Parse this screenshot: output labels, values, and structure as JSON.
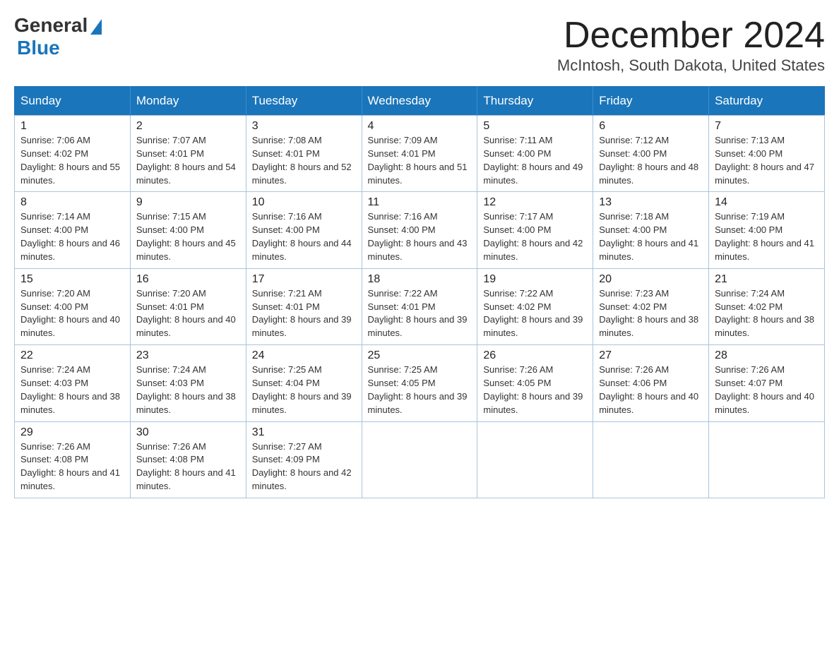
{
  "logo": {
    "general": "General",
    "blue": "Blue"
  },
  "title": "December 2024",
  "location": "McIntosh, South Dakota, United States",
  "days_of_week": [
    "Sunday",
    "Monday",
    "Tuesday",
    "Wednesday",
    "Thursday",
    "Friday",
    "Saturday"
  ],
  "weeks": [
    [
      {
        "day": "1",
        "sunrise": "7:06 AM",
        "sunset": "4:02 PM",
        "daylight": "8 hours and 55 minutes."
      },
      {
        "day": "2",
        "sunrise": "7:07 AM",
        "sunset": "4:01 PM",
        "daylight": "8 hours and 54 minutes."
      },
      {
        "day": "3",
        "sunrise": "7:08 AM",
        "sunset": "4:01 PM",
        "daylight": "8 hours and 52 minutes."
      },
      {
        "day": "4",
        "sunrise": "7:09 AM",
        "sunset": "4:01 PM",
        "daylight": "8 hours and 51 minutes."
      },
      {
        "day": "5",
        "sunrise": "7:11 AM",
        "sunset": "4:00 PM",
        "daylight": "8 hours and 49 minutes."
      },
      {
        "day": "6",
        "sunrise": "7:12 AM",
        "sunset": "4:00 PM",
        "daylight": "8 hours and 48 minutes."
      },
      {
        "day": "7",
        "sunrise": "7:13 AM",
        "sunset": "4:00 PM",
        "daylight": "8 hours and 47 minutes."
      }
    ],
    [
      {
        "day": "8",
        "sunrise": "7:14 AM",
        "sunset": "4:00 PM",
        "daylight": "8 hours and 46 minutes."
      },
      {
        "day": "9",
        "sunrise": "7:15 AM",
        "sunset": "4:00 PM",
        "daylight": "8 hours and 45 minutes."
      },
      {
        "day": "10",
        "sunrise": "7:16 AM",
        "sunset": "4:00 PM",
        "daylight": "8 hours and 44 minutes."
      },
      {
        "day": "11",
        "sunrise": "7:16 AM",
        "sunset": "4:00 PM",
        "daylight": "8 hours and 43 minutes."
      },
      {
        "day": "12",
        "sunrise": "7:17 AM",
        "sunset": "4:00 PM",
        "daylight": "8 hours and 42 minutes."
      },
      {
        "day": "13",
        "sunrise": "7:18 AM",
        "sunset": "4:00 PM",
        "daylight": "8 hours and 41 minutes."
      },
      {
        "day": "14",
        "sunrise": "7:19 AM",
        "sunset": "4:00 PM",
        "daylight": "8 hours and 41 minutes."
      }
    ],
    [
      {
        "day": "15",
        "sunrise": "7:20 AM",
        "sunset": "4:00 PM",
        "daylight": "8 hours and 40 minutes."
      },
      {
        "day": "16",
        "sunrise": "7:20 AM",
        "sunset": "4:01 PM",
        "daylight": "8 hours and 40 minutes."
      },
      {
        "day": "17",
        "sunrise": "7:21 AM",
        "sunset": "4:01 PM",
        "daylight": "8 hours and 39 minutes."
      },
      {
        "day": "18",
        "sunrise": "7:22 AM",
        "sunset": "4:01 PM",
        "daylight": "8 hours and 39 minutes."
      },
      {
        "day": "19",
        "sunrise": "7:22 AM",
        "sunset": "4:02 PM",
        "daylight": "8 hours and 39 minutes."
      },
      {
        "day": "20",
        "sunrise": "7:23 AM",
        "sunset": "4:02 PM",
        "daylight": "8 hours and 38 minutes."
      },
      {
        "day": "21",
        "sunrise": "7:24 AM",
        "sunset": "4:02 PM",
        "daylight": "8 hours and 38 minutes."
      }
    ],
    [
      {
        "day": "22",
        "sunrise": "7:24 AM",
        "sunset": "4:03 PM",
        "daylight": "8 hours and 38 minutes."
      },
      {
        "day": "23",
        "sunrise": "7:24 AM",
        "sunset": "4:03 PM",
        "daylight": "8 hours and 38 minutes."
      },
      {
        "day": "24",
        "sunrise": "7:25 AM",
        "sunset": "4:04 PM",
        "daylight": "8 hours and 39 minutes."
      },
      {
        "day": "25",
        "sunrise": "7:25 AM",
        "sunset": "4:05 PM",
        "daylight": "8 hours and 39 minutes."
      },
      {
        "day": "26",
        "sunrise": "7:26 AM",
        "sunset": "4:05 PM",
        "daylight": "8 hours and 39 minutes."
      },
      {
        "day": "27",
        "sunrise": "7:26 AM",
        "sunset": "4:06 PM",
        "daylight": "8 hours and 40 minutes."
      },
      {
        "day": "28",
        "sunrise": "7:26 AM",
        "sunset": "4:07 PM",
        "daylight": "8 hours and 40 minutes."
      }
    ],
    [
      {
        "day": "29",
        "sunrise": "7:26 AM",
        "sunset": "4:08 PM",
        "daylight": "8 hours and 41 minutes."
      },
      {
        "day": "30",
        "sunrise": "7:26 AM",
        "sunset": "4:08 PM",
        "daylight": "8 hours and 41 minutes."
      },
      {
        "day": "31",
        "sunrise": "7:27 AM",
        "sunset": "4:09 PM",
        "daylight": "8 hours and 42 minutes."
      },
      null,
      null,
      null,
      null
    ]
  ]
}
